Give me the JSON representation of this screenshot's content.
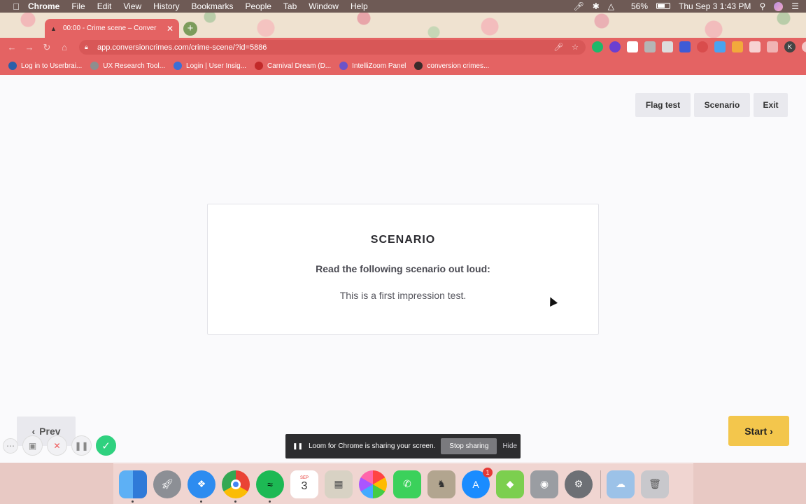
{
  "menubar": {
    "app_name": "Chrome",
    "menus": [
      "File",
      "Edit",
      "View",
      "History",
      "Bookmarks",
      "People",
      "Tab",
      "Window",
      "Help"
    ],
    "battery": "56%",
    "clock": "Thu Sep 3  1:43 PM"
  },
  "browser": {
    "tab_title": "00:00 - Crime scene – Conver",
    "url": "app.conversioncrimes.com/crime-scene/?id=5886",
    "profile_initial": "K",
    "bookmarks": [
      {
        "label": "Log in to Userbrai...",
        "color": "#2b5fa8"
      },
      {
        "label": "UX Research Tool...",
        "color": "#8e8e8e"
      },
      {
        "label": "Login | User Insig...",
        "color": "#3d6fd6"
      },
      {
        "label": "Carnival Dream (D...",
        "color": "#c22a2a"
      },
      {
        "label": "IntelliZoom Panel",
        "color": "#6c53c8"
      },
      {
        "label": "conversion crimes...",
        "color": "#3a2a2a"
      }
    ]
  },
  "page": {
    "flag_label": "Flag test",
    "scenario_label": "Scenario",
    "exit_label": "Exit",
    "card": {
      "heading": "SCENARIO",
      "instruction": "Read the following scenario out loud:",
      "text": "This is a first impression test."
    },
    "prev_label": "Prev",
    "start_label": "Start"
  },
  "loom": {
    "message": "Loom for Chrome is sharing your screen.",
    "stop_label": "Stop sharing",
    "hide_label": "Hide"
  },
  "dock": {
    "calendar_month": "SEP",
    "calendar_day": "3",
    "appstore_badge": "1"
  },
  "colors": {
    "chrome_accent": "#e46363",
    "start_button": "#f3c64c",
    "loom_done": "#2fd17f"
  }
}
